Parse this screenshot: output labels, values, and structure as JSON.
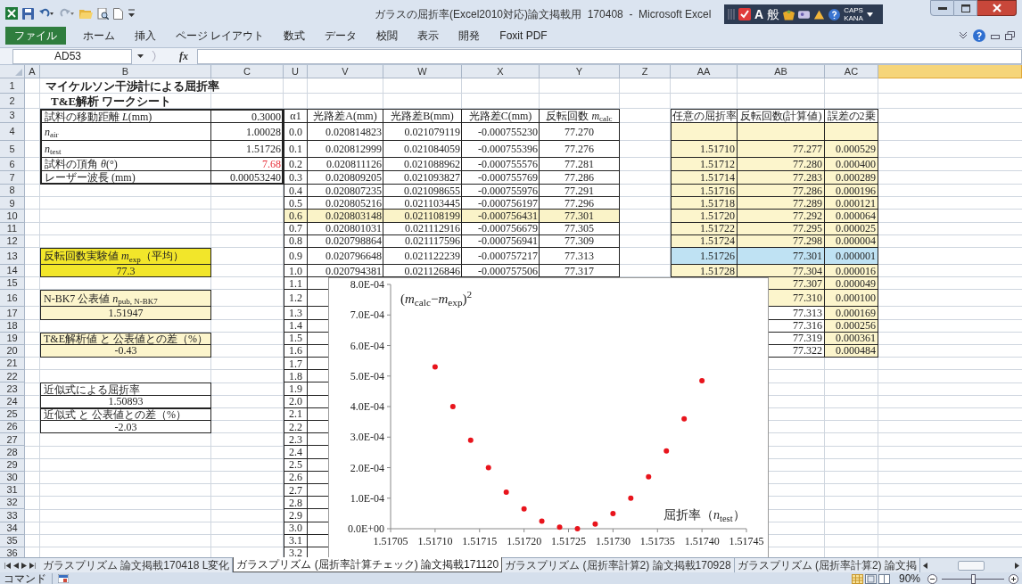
{
  "window": {
    "title": "ガラスの屈折率(Excel2010対応)論文掲載用  170408  -  Microsoft Excel"
  },
  "ime_bar": {
    "mode": "A",
    "input": "般",
    "caps": "CAPS",
    "kana": "KANA"
  },
  "ribbon_tabs": [
    {
      "label": "ファイル",
      "kind": "file",
      "selected": false
    },
    {
      "label": "ホーム",
      "kind": "tab",
      "selected": false
    },
    {
      "label": "挿入",
      "kind": "tab",
      "selected": false
    },
    {
      "label": "ページ レイアウト",
      "kind": "tab",
      "selected": false
    },
    {
      "label": "数式",
      "kind": "tab",
      "selected": false
    },
    {
      "label": "データ",
      "kind": "tab",
      "selected": false
    },
    {
      "label": "校閲",
      "kind": "tab",
      "selected": false
    },
    {
      "label": "表示",
      "kind": "tab",
      "selected": false
    },
    {
      "label": "開発",
      "kind": "tab",
      "selected": false
    },
    {
      "label": "Foxit PDF",
      "kind": "tab",
      "selected": false
    }
  ],
  "formula_bar": {
    "name_box": "AD53",
    "fx": "fx"
  },
  "sheet": {
    "columns": [
      {
        "label": "A",
        "selected": false
      },
      {
        "label": "B",
        "selected": false
      },
      {
        "label": "C",
        "selected": false
      },
      {
        "label": "U",
        "selected": false
      },
      {
        "label": "V",
        "selected": false
      },
      {
        "label": "W",
        "selected": false
      },
      {
        "label": "X",
        "selected": false
      },
      {
        "label": "Y",
        "selected": false
      },
      {
        "label": "Z",
        "selected": false
      },
      {
        "label": "AA",
        "selected": false
      },
      {
        "label": "AB",
        "selected": false
      },
      {
        "label": "AC",
        "selected": false
      },
      {
        "selected": true
      }
    ],
    "row_numbers": [
      "1",
      "2",
      "3",
      "4",
      "5",
      "6",
      "7",
      "8",
      "9",
      "10",
      "11",
      "12",
      "13",
      "14",
      "15",
      "16",
      "17",
      "18",
      "19",
      "20",
      "21",
      "22",
      "23",
      "24",
      "25",
      "26",
      "27",
      "28",
      "29",
      "30",
      "31",
      "32",
      "33",
      "34",
      "35",
      "36"
    ],
    "title": "マイケルソン干渉計による屈折率",
    "subtitle": "T&E解析 ワークシート",
    "parameters": [
      {
        "label": "試料の移動距離 *L*(mm)",
        "value": "0.3000",
        "warning": false
      },
      {
        "label": "*n*$_{air}$",
        "value": "1.00028",
        "warning": false
      },
      {
        "label": "*n*$_{test}$",
        "value": "1.51726",
        "warning": false
      },
      {
        "label": "試料の頂角 *θ*(°)",
        "value": "7.68",
        "warning": true
      },
      {
        "label": "レーザー波長 (mm)",
        "value": "0.00053240",
        "warning": false
      }
    ],
    "results": [
      {
        "label": "反転回数実験値 *m*$_{exp}$（平均）",
        "value": "77.3",
        "color": "#f2e62a"
      },
      {
        "label": "N-BK7 公表値 *n*$_{pub, N-BK7}$",
        "value": "1.51947",
        "color": "#fcf5cc"
      },
      {
        "label": "T&E解析値 と 公表値との差（%）",
        "value": "-0.43",
        "color": "#fcf5cc"
      },
      {
        "label": "近似式による屈折率",
        "value": "1.50893",
        "color": "#ffffff"
      },
      {
        "label": "近似式 と 公表値との差（%）",
        "value": "-2.03",
        "color": "#ffffff"
      }
    ],
    "calc_table": {
      "columns": [
        "α1",
        "光路差A(mm)",
        "光路差B(mm)",
        "光路差C(mm)",
        "反転回数 *m*$_{calc}$"
      ],
      "rows": [
        {
          "cells": [
            "0.0",
            "0.020814823",
            "0.021079119",
            "-0.000755230",
            "77.270"
          ],
          "highlighted": false
        },
        {
          "cells": [
            "0.1",
            "0.020812999",
            "0.021084059",
            "-0.000755396",
            "77.276"
          ],
          "highlighted": false
        },
        {
          "cells": [
            "0.2",
            "0.020811126",
            "0.021088962",
            "-0.000755576",
            "77.281"
          ],
          "highlighted": false
        },
        {
          "cells": [
            "0.3",
            "0.020809205",
            "0.021093827",
            "-0.000755769",
            "77.286"
          ],
          "highlighted": false
        },
        {
          "cells": [
            "0.4",
            "0.020807235",
            "0.021098655",
            "-0.000755976",
            "77.291"
          ],
          "highlighted": false
        },
        {
          "cells": [
            "0.5",
            "0.020805216",
            "0.021103445",
            "-0.000756197",
            "77.296"
          ],
          "highlighted": false
        },
        {
          "cells": [
            "0.6",
            "0.020803148",
            "0.021108199",
            "-0.000756431",
            "77.301"
          ],
          "highlighted": true
        },
        {
          "cells": [
            "0.7",
            "0.020801031",
            "0.021112916",
            "-0.000756679",
            "77.305"
          ],
          "highlighted": false
        },
        {
          "cells": [
            "0.8",
            "0.020798864",
            "0.021117596",
            "-0.000756941",
            "77.309"
          ],
          "highlighted": false
        },
        {
          "cells": [
            "0.9",
            "0.020796648",
            "0.021122239",
            "-0.000757217",
            "77.313"
          ],
          "highlighted": false
        },
        {
          "cells": [
            "1.0",
            "0.020794381",
            "0.021126846",
            "-0.000757506",
            "77.317"
          ],
          "highlighted": false
        },
        {
          "cells": [
            "1.1"
          ],
          "highlighted": false
        },
        {
          "cells": [
            "1.2"
          ],
          "highlighted": false
        },
        {
          "cells": [
            "1.3"
          ],
          "highlighted": false
        },
        {
          "cells": [
            "1.4"
          ],
          "highlighted": false
        },
        {
          "cells": [
            "1.5"
          ],
          "highlighted": false
        },
        {
          "cells": [
            "1.6"
          ],
          "highlighted": false
        },
        {
          "cells": [
            "1.7"
          ],
          "highlighted": false
        },
        {
          "cells": [
            "1.8"
          ],
          "highlighted": false
        },
        {
          "cells": [
            "1.9"
          ],
          "highlighted": false
        },
        {
          "cells": [
            "2.0"
          ],
          "highlighted": false
        },
        {
          "cells": [
            "2.1"
          ],
          "highlighted": false
        },
        {
          "cells": [
            "2.2"
          ],
          "highlighted": false
        },
        {
          "cells": [
            "2.3"
          ],
          "highlighted": false
        },
        {
          "cells": [
            "2.4"
          ],
          "highlighted": false
        },
        {
          "cells": [
            "2.5"
          ],
          "highlighted": false
        },
        {
          "cells": [
            "2.6"
          ],
          "highlighted": false
        },
        {
          "cells": [
            "2.7"
          ],
          "highlighted": false
        },
        {
          "cells": [
            "2.8"
          ],
          "highlighted": false
        },
        {
          "cells": [
            "2.9"
          ],
          "highlighted": false
        },
        {
          "cells": [
            "3.0"
          ],
          "highlighted": false
        },
        {
          "cells": [
            "3.1"
          ],
          "highlighted": false
        },
        {
          "cells": [
            "3.2"
          ],
          "highlighted": false
        }
      ]
    },
    "fit_table": {
      "columns": [
        "任意の屈折率",
        "反転回数(計算値)",
        "誤差の2乗"
      ],
      "rows": [
        {
          "cells": [
            "1.51710",
            "77.277",
            "0.000529"
          ],
          "color": "#fcf5cc",
          "middle_filled": true
        },
        {
          "cells": [
            "1.51712",
            "77.280",
            "0.000400"
          ],
          "color": "#fcf5cc",
          "middle_filled": true
        },
        {
          "cells": [
            "1.51714",
            "77.283",
            "0.000289"
          ],
          "color": "#fcf5cc",
          "middle_filled": true
        },
        {
          "cells": [
            "1.51716",
            "77.286",
            "0.000196"
          ],
          "color": "#fcf5cc",
          "middle_filled": true
        },
        {
          "cells": [
            "1.51718",
            "77.289",
            "0.000121"
          ],
          "color": "#fcf5cc",
          "middle_filled": true
        },
        {
          "cells": [
            "1.51720",
            "77.292",
            "0.000064"
          ],
          "color": "#fcf5cc",
          "middle_filled": true
        },
        {
          "cells": [
            "1.51722",
            "77.295",
            "0.000025"
          ],
          "color": "#fcf5cc",
          "middle_filled": true
        },
        {
          "cells": [
            "1.51724",
            "77.298",
            "0.000004"
          ],
          "color": "#fcf5cc",
          "middle_filled": true
        },
        {
          "cells": [
            "1.51726",
            "77.301",
            "0.000001"
          ],
          "color": "#bfe2f3",
          "middle_filled": true
        },
        {
          "cells": [
            "1.51728",
            "77.304",
            "0.000016"
          ],
          "color": "#fcf5cc",
          "middle_filled": true
        },
        {
          "cells": [
            "77.307",
            "0.000049"
          ],
          "color": "#fcf5cc",
          "middle_filled": true
        },
        {
          "cells": [
            "77.310",
            "0.000100"
          ],
          "color": "#fcf5cc",
          "middle_filled": true
        },
        {
          "cells": [
            "77.313",
            "0.000169"
          ],
          "color": "#fcf5cc",
          "middle_filled": false
        },
        {
          "cells": [
            "77.316",
            "0.000256"
          ],
          "color": "#fcf5cc",
          "middle_filled": false
        },
        {
          "cells": [
            "77.319",
            "0.000361"
          ],
          "color": "#fcf5cc",
          "middle_filled": false
        },
        {
          "cells": [
            "77.322",
            "0.000484"
          ],
          "color": "#fcf5cc",
          "middle_filled": false
        }
      ]
    },
    "chart": {
      "chart_data": {
        "type": "scatter",
        "title": "(*m*$_{calc}$−*m*$_{exp}$)$^{2}$",
        "xlabel": "屈折率（*n*$_{test}$）",
        "x": [
          1.5171,
          1.51712,
          1.51714,
          1.51716,
          1.51718,
          1.5172,
          1.51722,
          1.51724,
          1.51726,
          1.51728,
          1.5173,
          1.51732,
          1.51734,
          1.51736,
          1.51738,
          1.5174
        ],
        "series": [
          {
            "color": "#e8141c",
            "values": [
              0.00053,
              0.0004,
              0.00029,
              0.0002,
              0.00012,
              6.5e-05,
              2.5e-05,
              5e-06,
              0,
              1.5e-05,
              5e-05,
              0.0001,
              0.00017,
              0.000255,
              0.00036,
              0.000485
            ]
          }
        ],
        "xlim": [
          1.51705,
          1.51745
        ],
        "ylim": [
          0,
          0.0008
        ],
        "xticks": [
          {
            "value": 1.51705,
            "label": "1.51705"
          },
          {
            "value": 1.5171,
            "label": "1.51710"
          },
          {
            "value": 1.51715,
            "label": "1.51715"
          },
          {
            "value": 1.5172,
            "label": "1.51720"
          },
          {
            "value": 1.51725,
            "label": "1.51725"
          },
          {
            "value": 1.5173,
            "label": "1.51730"
          },
          {
            "value": 1.51735,
            "label": "1.51735"
          },
          {
            "value": 1.5174,
            "label": "1.51740"
          },
          {
            "value": 1.51745,
            "label": "1.51745"
          }
        ],
        "yticks": [
          {
            "value": 0,
            "label": "0.0E+00"
          },
          {
            "value": 0.0001,
            "label": "1.0E-04"
          },
          {
            "value": 0.0002,
            "label": "2.0E-04"
          },
          {
            "value": 0.0003,
            "label": "3.0E-04"
          },
          {
            "value": 0.0004,
            "label": "4.0E-04"
          },
          {
            "value": 0.0005,
            "label": "5.0E-04"
          },
          {
            "value": 0.0006,
            "label": "6.0E-04"
          },
          {
            "value": 0.0007,
            "label": "7.0E-04"
          },
          {
            "value": 0.0008,
            "label": "8.0E-04"
          }
        ]
      }
    }
  },
  "sheet_tabs": [
    {
      "label": "ガラスプリズム 論文掲載170418 L変化",
      "selected": false
    },
    {
      "label": "ガラスプリズム (屈折率計算チェック) 論文掲載171120",
      "selected": true
    },
    {
      "label": "ガラスプリズム (屈折率計算2) 論文掲載170928",
      "selected": false
    },
    {
      "label": "ガラスプリズム (屈折率計算2) 論文掲",
      "selected": false
    }
  ],
  "status_bar": {
    "mode": "コマンド",
    "zoom": "90%",
    "zoom_slider": {
      "level": 0.5
    }
  }
}
